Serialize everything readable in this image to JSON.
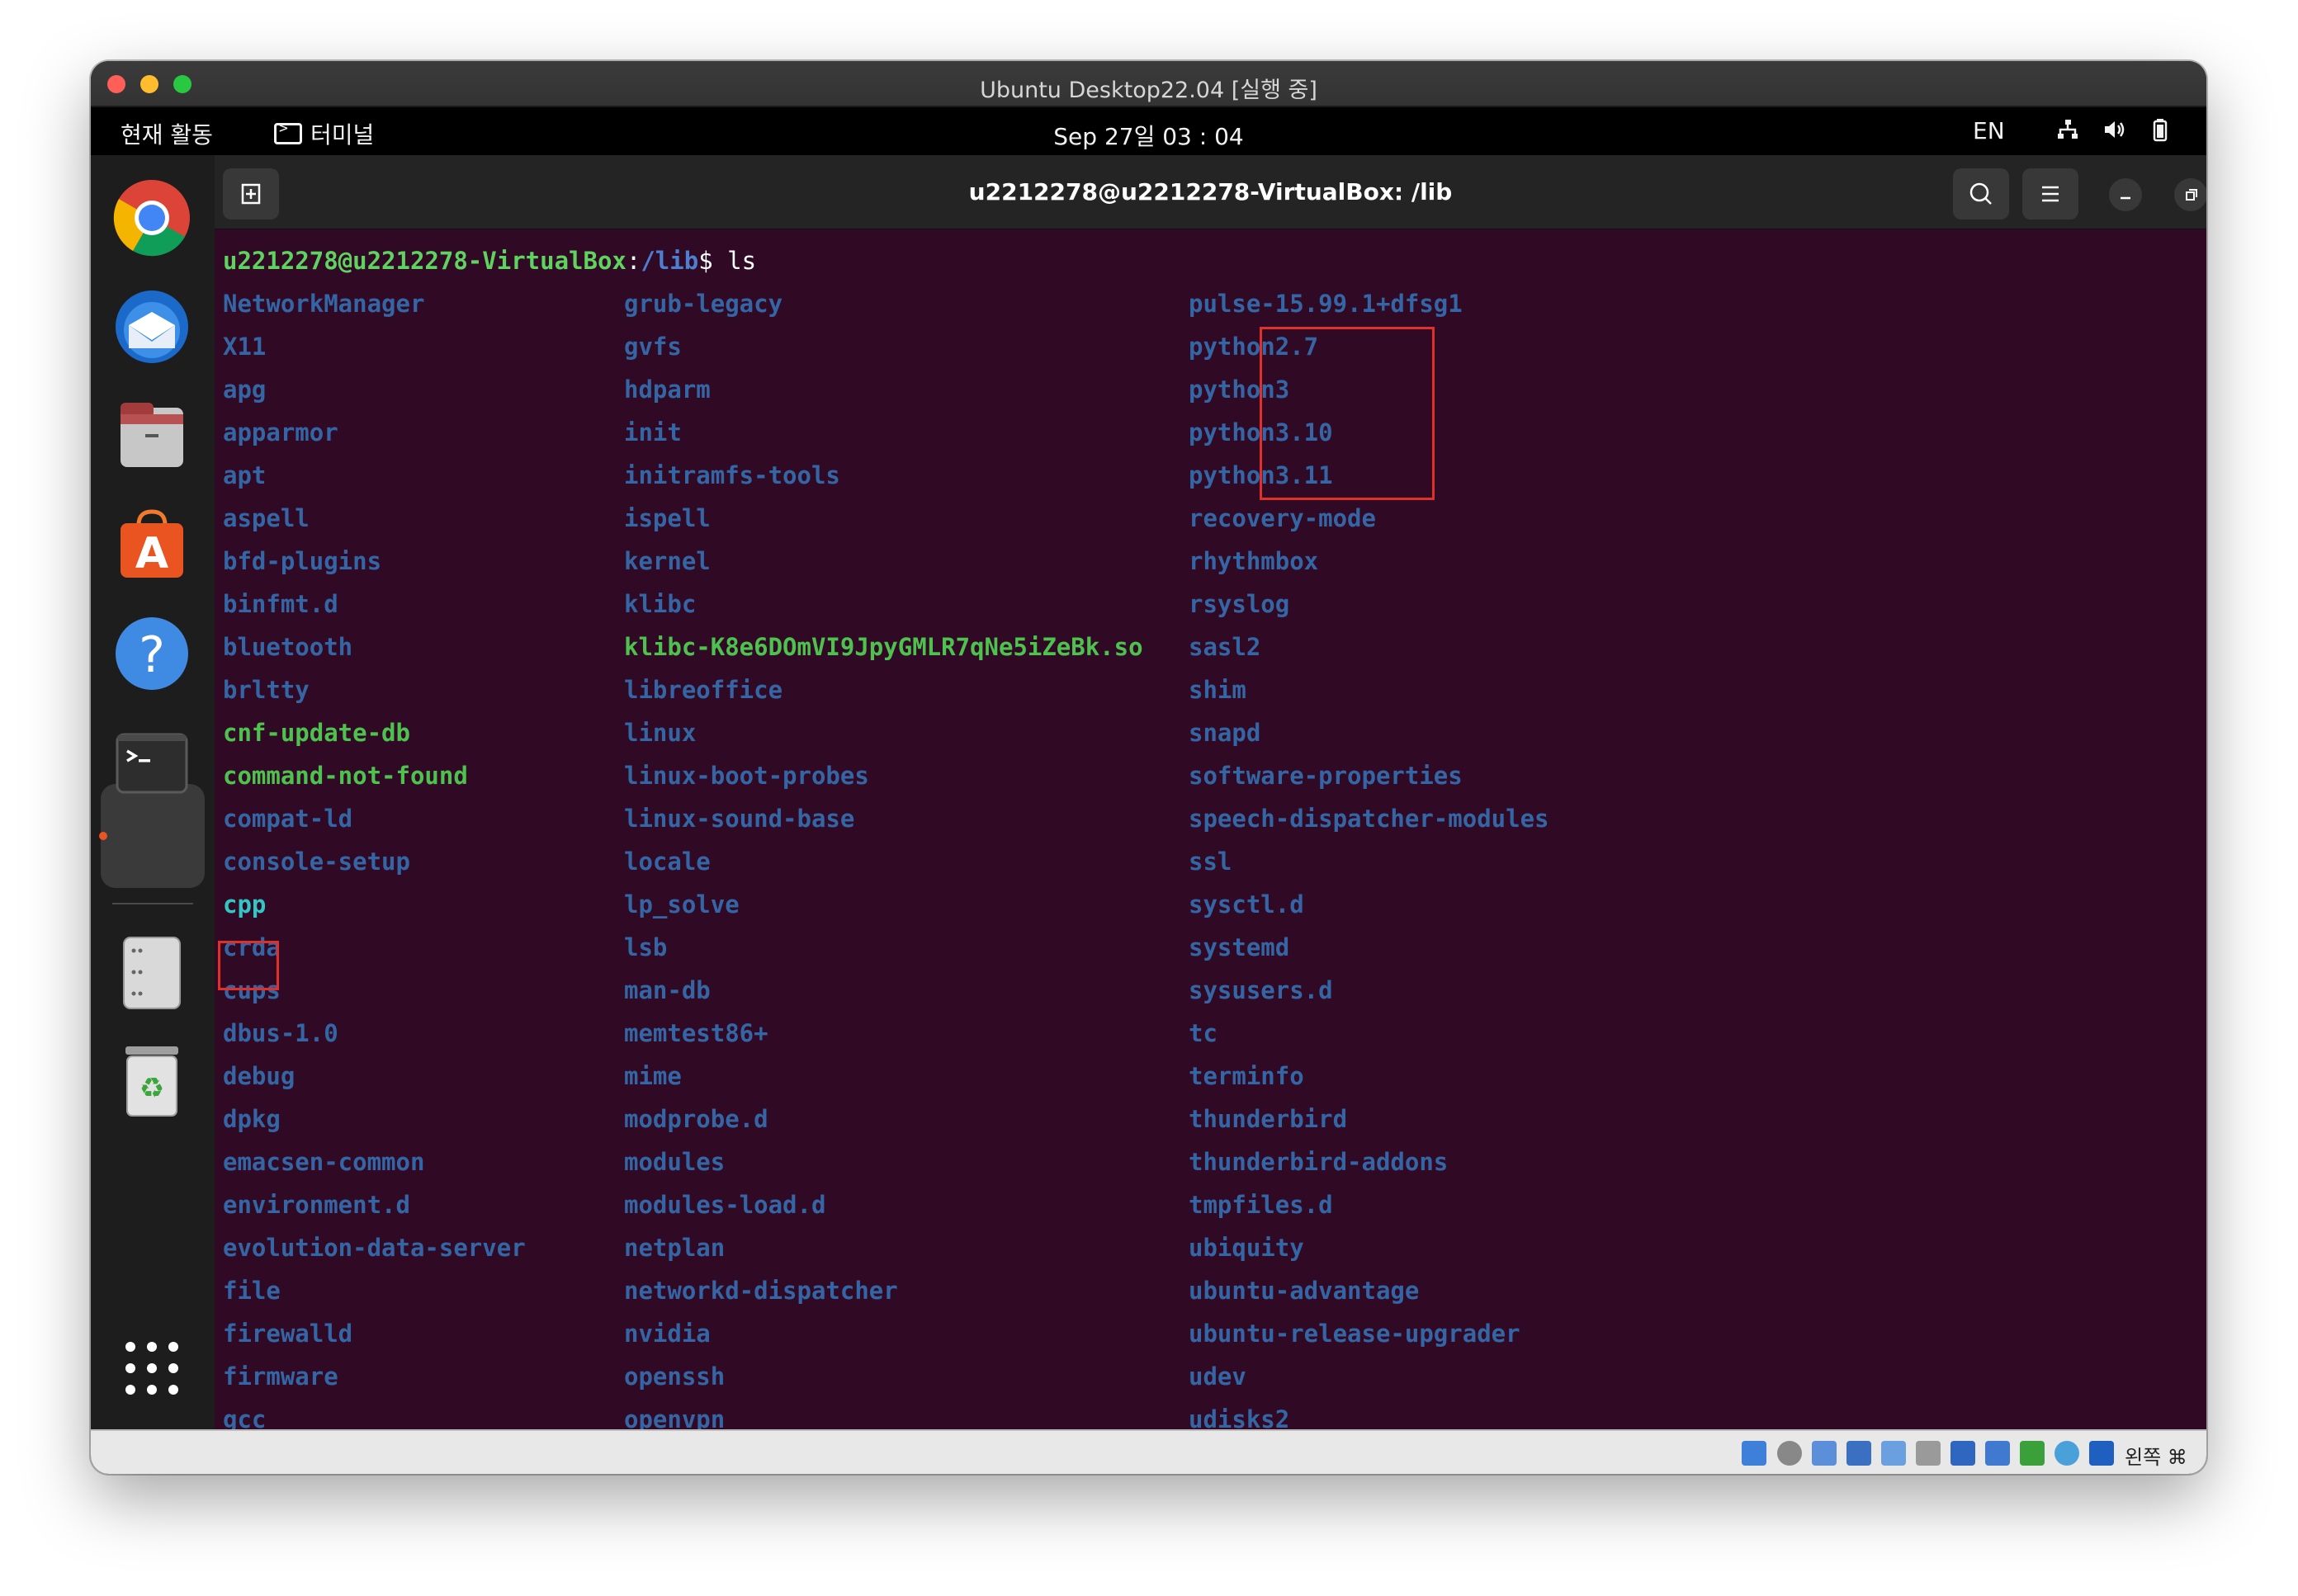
{
  "window": {
    "title": "Ubuntu Desktop22.04 [실행 중]"
  },
  "topbar": {
    "activities": "현재 활동",
    "app_name": "터미널",
    "clock": "Sep 27일  03 : 04",
    "lang": "EN",
    "tray_icons": [
      "network-icon",
      "volume-icon",
      "battery-icon"
    ]
  },
  "dock": {
    "apps": [
      "chrome-icon",
      "thunderbird-icon",
      "files-icon",
      "app-center-icon",
      "help-icon",
      "terminal-icon",
      "disk-icon",
      "trash-icon",
      "show-apps-icon"
    ]
  },
  "terminal": {
    "title": "u2212278@u2212278-VirtualBox: /lib",
    "prompt": {
      "user": "u2212278@u2212278-VirtualBox",
      "colon": ":",
      "path": "/lib",
      "dollar": "$",
      "command": " ls"
    },
    "columns": [
      [
        {
          "name": "NetworkManager",
          "type": "dir"
        },
        {
          "name": "X11",
          "type": "dir"
        },
        {
          "name": "apg",
          "type": "dir"
        },
        {
          "name": "apparmor",
          "type": "dir"
        },
        {
          "name": "apt",
          "type": "dir"
        },
        {
          "name": "aspell",
          "type": "dir"
        },
        {
          "name": "bfd-plugins",
          "type": "dir"
        },
        {
          "name": "binfmt.d",
          "type": "dir"
        },
        {
          "name": "bluetooth",
          "type": "dir"
        },
        {
          "name": "brltty",
          "type": "dir"
        },
        {
          "name": "cnf-update-db",
          "type": "exec"
        },
        {
          "name": "command-not-found",
          "type": "exec"
        },
        {
          "name": "compat-ld",
          "type": "dir"
        },
        {
          "name": "console-setup",
          "type": "dir"
        },
        {
          "name": "cpp",
          "type": "link"
        },
        {
          "name": "crda",
          "type": "dir"
        },
        {
          "name": "cups",
          "type": "dir"
        },
        {
          "name": "dbus-1.0",
          "type": "dir"
        },
        {
          "name": "debug",
          "type": "dir"
        },
        {
          "name": "dpkg",
          "type": "dir"
        },
        {
          "name": "emacsen-common",
          "type": "dir"
        },
        {
          "name": "environment.d",
          "type": "dir"
        },
        {
          "name": "evolution-data-server",
          "type": "dir"
        },
        {
          "name": "file",
          "type": "dir"
        },
        {
          "name": "firewalld",
          "type": "dir"
        },
        {
          "name": "firmware",
          "type": "dir"
        },
        {
          "name": "gcc",
          "type": "dir"
        }
      ],
      [
        {
          "name": "grub-legacy",
          "type": "dir"
        },
        {
          "name": "gvfs",
          "type": "dir"
        },
        {
          "name": "hdparm",
          "type": "dir"
        },
        {
          "name": "init",
          "type": "dir"
        },
        {
          "name": "initramfs-tools",
          "type": "dir"
        },
        {
          "name": "ispell",
          "type": "dir"
        },
        {
          "name": "kernel",
          "type": "dir"
        },
        {
          "name": "klibc",
          "type": "dir"
        },
        {
          "name": "klibc-K8e6DOmVI9JpyGMLR7qNe5iZeBk.so",
          "type": "exec"
        },
        {
          "name": "libreoffice",
          "type": "dir"
        },
        {
          "name": "linux",
          "type": "dir"
        },
        {
          "name": "linux-boot-probes",
          "type": "dir"
        },
        {
          "name": "linux-sound-base",
          "type": "dir"
        },
        {
          "name": "locale",
          "type": "dir"
        },
        {
          "name": "lp_solve",
          "type": "dir"
        },
        {
          "name": "lsb",
          "type": "dir"
        },
        {
          "name": "man-db",
          "type": "dir"
        },
        {
          "name": "memtest86+",
          "type": "dir"
        },
        {
          "name": "mime",
          "type": "dir"
        },
        {
          "name": "modprobe.d",
          "type": "dir"
        },
        {
          "name": "modules",
          "type": "dir"
        },
        {
          "name": "modules-load.d",
          "type": "dir"
        },
        {
          "name": "netplan",
          "type": "dir"
        },
        {
          "name": "networkd-dispatcher",
          "type": "dir"
        },
        {
          "name": "nvidia",
          "type": "dir"
        },
        {
          "name": "openssh",
          "type": "dir"
        },
        {
          "name": "openvpn",
          "type": "dir"
        }
      ],
      [
        {
          "name": "pulse-15.99.1+dfsg1",
          "type": "dir"
        },
        {
          "name": "python2.7",
          "type": "dir"
        },
        {
          "name": "python3",
          "type": "dir"
        },
        {
          "name": "python3.10",
          "type": "dir"
        },
        {
          "name": "python3.11",
          "type": "dir"
        },
        {
          "name": "recovery-mode",
          "type": "dir"
        },
        {
          "name": "rhythmbox",
          "type": "dir"
        },
        {
          "name": "rsyslog",
          "type": "dir"
        },
        {
          "name": "sasl2",
          "type": "dir"
        },
        {
          "name": "shim",
          "type": "dir"
        },
        {
          "name": "snapd",
          "type": "dir"
        },
        {
          "name": "software-properties",
          "type": "dir"
        },
        {
          "name": "speech-dispatcher-modules",
          "type": "dir"
        },
        {
          "name": "ssl",
          "type": "dir"
        },
        {
          "name": "sysctl.d",
          "type": "dir"
        },
        {
          "name": "systemd",
          "type": "dir"
        },
        {
          "name": "sysusers.d",
          "type": "dir"
        },
        {
          "name": "tc",
          "type": "dir"
        },
        {
          "name": "terminfo",
          "type": "dir"
        },
        {
          "name": "thunderbird",
          "type": "dir"
        },
        {
          "name": "thunderbird-addons",
          "type": "dir"
        },
        {
          "name": "tmpfiles.d",
          "type": "dir"
        },
        {
          "name": "ubiquity",
          "type": "dir"
        },
        {
          "name": "ubuntu-advantage",
          "type": "dir"
        },
        {
          "name": "ubuntu-release-upgrader",
          "type": "dir"
        },
        {
          "name": "udev",
          "type": "dir"
        },
        {
          "name": "udisks2",
          "type": "dir"
        }
      ]
    ]
  },
  "statusbar": {
    "host_key": "왼쪽 ⌘"
  },
  "colors": {
    "accent": "#e95420",
    "terminal_bg": "#300a24",
    "dir": "#3465a4",
    "exec": "#4ec24e",
    "link": "#34c5c5",
    "highlight": "#e0302a"
  }
}
